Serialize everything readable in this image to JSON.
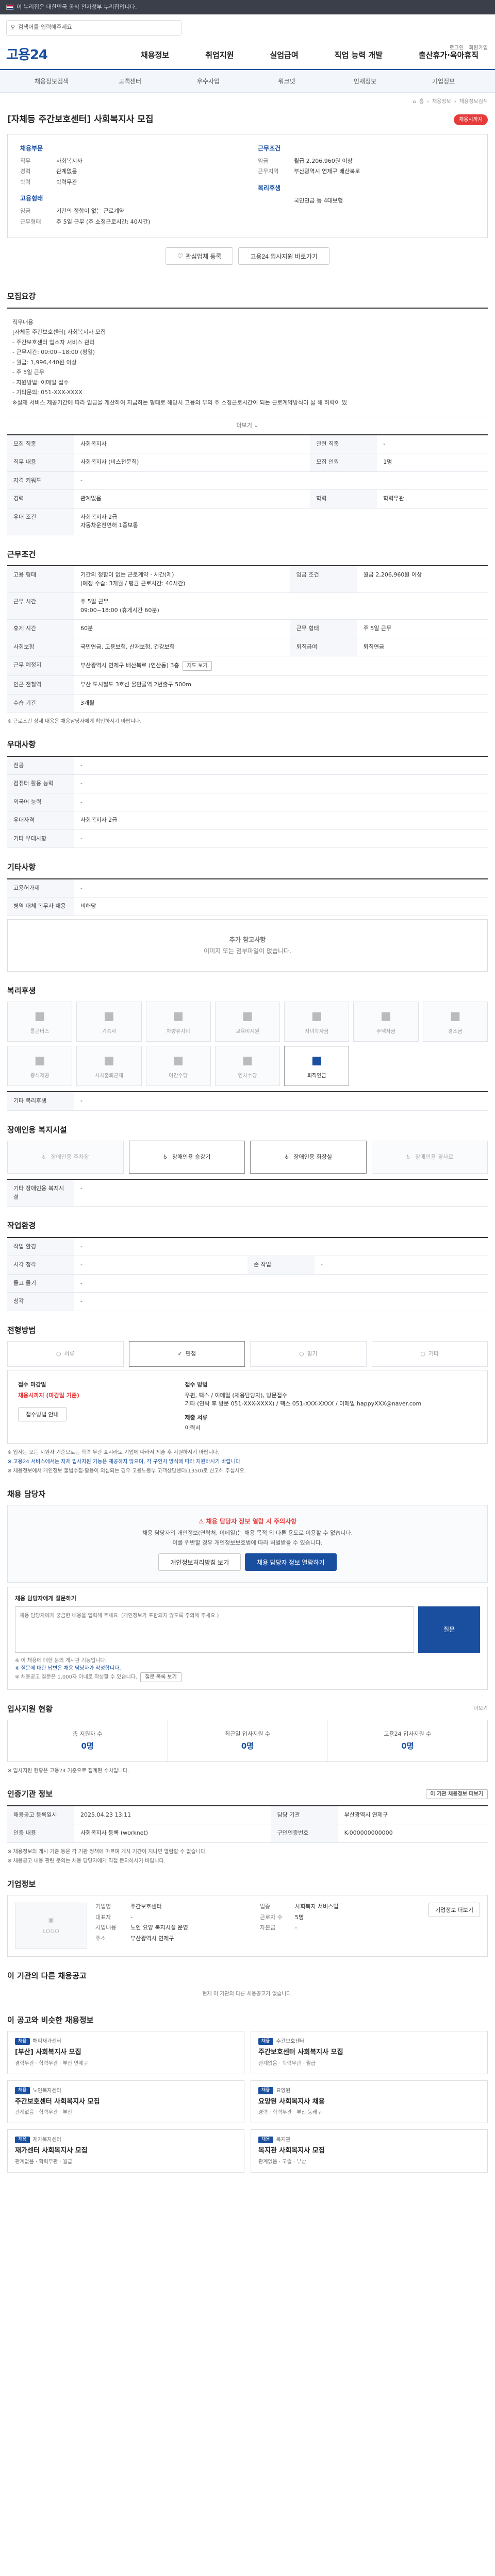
{
  "topbar": {
    "notice": "이 누리집은 대한민국 공식 전자정부 누리집입니다."
  },
  "search": {
    "placeholder": "검색어를 입력해주세요"
  },
  "util": {
    "login": "로그인",
    "join": "회원가입"
  },
  "logo": "고용24",
  "gnb": [
    "채용정보",
    "취업지원",
    "실업급여",
    "직업 능력 개발",
    "출산휴가·육아휴직"
  ],
  "subnav": [
    "채용정보검색",
    "고객센터",
    "우수사업",
    "워크넷",
    "인재정보",
    "기업정보"
  ],
  "breadcrumb": [
    "홈",
    "채용정보",
    "채용정보검색"
  ],
  "job": {
    "title": "[자체등 주간보호센터] 사회복지사 모집",
    "badge": "채용시까지",
    "summary_left_heading": "채용부문",
    "summary_left": [
      {
        "k": "직무",
        "v": "사회복지사"
      },
      {
        "k": "경력",
        "v": "관계없음"
      },
      {
        "k": "학력",
        "v": "학력무관"
      }
    ],
    "summary_left_heading2": "고용형태",
    "summary_left2": [
      {
        "k": "임금",
        "v": "기간의 정함이 없는 근로계약"
      },
      {
        "k": "근무형태",
        "v": "주 5일 근무 (주 소정근로시간: 40시간)"
      }
    ],
    "summary_right_heading": "근무조건",
    "summary_right": [
      {
        "k": "임금",
        "v": "월급 2,206,960원 이상"
      },
      {
        "k": "근무지역",
        "v": "부산광역시 연제구 배산북로"
      },
      {
        "k": "",
        "v": ""
      }
    ],
    "summary_right_heading2": "복리후생",
    "summary_right2": [
      {
        "k": "",
        "v": "국민연금 등 4대보험"
      }
    ],
    "btn_scrap": "관심업체 등록",
    "btn_share": "고용24 입사지원 바로가기"
  },
  "detail": {
    "heading": "모집요강",
    "lines": [
      "직무내용",
      "[자체등 주간보호센터] 사회복지사 모집",
      "- 주간보호센터 입소자 서비스 관리",
      "- 근무시간: 09:00~18:00 (평일)",
      "- 월급: 1,996,440원 이상",
      "- 주 5일 근무",
      "- 지원방법: 이메일 접수",
      "- 기타문의: 051-XXX-XXXX",
      "※실제 서비스 제공기간에 따라 임금을 개산하여 지급하는 형태로 해당시 고용의 부의 주 소정근로시간이 되는 근로계약방식이 될 해 허락이 있"
    ],
    "expand": "더보기"
  },
  "info_table": {
    "rows": [
      {
        "k": "모집 직종",
        "v": "사회복지사",
        "k2": "관련 직종",
        "v2": "-"
      },
      {
        "k": "직무 내용",
        "v": "사회복지사 (비스전문직)",
        "k2": "모집 인원",
        "v2": "1명"
      },
      {
        "k": "자격 키워드",
        "v": "-",
        "k2": "",
        "v2": ""
      },
      {
        "k": "경력",
        "v": "관계없음",
        "k2": "학력",
        "v2": "학력무관"
      },
      {
        "k": "우대 조건",
        "v": "사회복지사 2급\n자동차운전면허 1종보통",
        "k2": "",
        "v2": ""
      }
    ]
  },
  "work_cond": {
    "heading": "근무조건",
    "rows": [
      {
        "k": "고용 형태",
        "v": "기간의 정함이 없는 근로계약 · 시간(제)\n(예정 수습: 3개월 / 평균 근로시간: 40시간)",
        "k2": "임금 조건",
        "v2": "월급 2,206,960원 이상"
      },
      {
        "k": "근무 시간",
        "v": "주 5일 근무\n09:00~18:00 (휴게시간 60분)",
        "k2": "",
        "v2": ""
      },
      {
        "k": "휴게 시간",
        "v": "60분",
        "k2": "근무 형태",
        "v2": "주 5일 근무"
      },
      {
        "k": "사회보험",
        "v": "국민연금, 고용보험, 산재보험, 건강보험",
        "k2": "퇴직급여",
        "v2": "퇴직연금"
      },
      {
        "k": "근무 예정지",
        "v": "부산광역시 연제구 배산북로 (연산동) 3층",
        "k2": "",
        "v2": ""
      },
      {
        "k": "인근 전철역",
        "v": "부산 도시철도 3호선 물만골역 2번출구 500m",
        "k2": "",
        "v2": ""
      },
      {
        "k": "수습 기간",
        "v": "3개월",
        "k2": "",
        "v2": ""
      }
    ],
    "map_btn": "지도 보기",
    "note": "※ 근로조건 상세 내용은 채용담당자에게 확인하시기 바랍니다."
  },
  "preference": {
    "heading": "우대사항",
    "rows": [
      {
        "k": "전공",
        "v": "-"
      },
      {
        "k": "컴퓨터 활용 능력",
        "v": "-"
      },
      {
        "k": "외국어 능력",
        "v": "-"
      },
      {
        "k": "우대자격",
        "v": "사회복지사 2급"
      },
      {
        "k": "기타 우대사항",
        "v": "-"
      }
    ]
  },
  "etc": {
    "heading": "기타사항",
    "rows": [
      {
        "k": "고용허가제",
        "v": "-"
      },
      {
        "k": "병역 대체 복무자 채용",
        "v": "비해당"
      }
    ]
  },
  "extra": {
    "heading": "추가 참고사항",
    "empty": "이미지 또는 첨부파일이 없습니다."
  },
  "welfare": {
    "heading": "복리후생",
    "items": [
      {
        "label": "통근버스",
        "on": false
      },
      {
        "label": "기숙사",
        "on": false
      },
      {
        "label": "차량유지비",
        "on": false
      },
      {
        "label": "교육비지원",
        "on": false
      },
      {
        "label": "자녀학자금",
        "on": false
      },
      {
        "label": "주택자금",
        "on": false
      },
      {
        "label": "경조금",
        "on": false
      },
      {
        "label": "중식제공",
        "on": false
      },
      {
        "label": "시차출퇴근제",
        "on": false
      },
      {
        "label": "야간수당",
        "on": false
      },
      {
        "label": "연차수당",
        "on": false
      },
      {
        "label": "퇴직연금",
        "on": true
      }
    ],
    "other_label": "기타 복리후생",
    "other_value": "-"
  },
  "facility": {
    "heading": "장애인용 복지시설",
    "items": [
      {
        "label": "장애인용 주차장",
        "on": false
      },
      {
        "label": "장애인용 승강기",
        "on": true
      },
      {
        "label": "장애인용 화장실",
        "on": true
      },
      {
        "label": "장애인용 경사로",
        "on": false
      }
    ],
    "other_label": "기타 장애인용 복지시설",
    "other_value": "-"
  },
  "workenv": {
    "heading": "작업환경",
    "rows": [
      {
        "k": "작업 환경",
        "v": "-",
        "k2": "",
        "v2": ""
      },
      {
        "k": "시각 청각",
        "v": "-",
        "k2": "손 작업",
        "v2": "-"
      },
      {
        "k": "들고 들기",
        "v": "-",
        "k2": "",
        "v2": ""
      },
      {
        "k": "청각",
        "v": "-",
        "k2": "",
        "v2": ""
      }
    ]
  },
  "selection": {
    "heading": "전형방법",
    "steps": [
      {
        "label": "서류",
        "on": false
      },
      {
        "label": "면접",
        "on": true
      },
      {
        "label": "필기",
        "on": false
      },
      {
        "label": "기타",
        "on": false
      }
    ]
  },
  "apply": {
    "col1_label": "접수 마감일",
    "col1_value": "채용시까지 (마감일 기준)",
    "col1_btn": "접수방법 안내",
    "col2_label": "접수 방법",
    "col2_value": "우편, 팩스 / 이메일 (채용담당자), 방문접수\n기타 (연락 후 방문 051-XXX-XXXX) / 팩스 051-XXX-XXXX / 이메일 happyXXX@naver.com",
    "col2b_label": "제출 서류",
    "col2b_value": "이력서"
  },
  "apply_notes": [
    "※ 입사는 모든 지원자 기준으로는 학력 무관 표시라도 기업에 따라서 제출 후 지원하시기 바랍니다.",
    "※ 고용24 서비스에서는 자체 입사지원 기능은 제공하지 않으며, 각 구인처 방식에 따라 지원하시기 바랍니다.",
    "※ 채용정보에서 개인정보 불법수집·활용이 의심되는 경우 고용노동부 고객상담센터(1350)로 신고해 주십시오."
  ],
  "recruiter": {
    "heading": "채용 담당자",
    "warn": "채용 담당자 정보 열람 시 주의사항",
    "lines": [
      "채용 담당자의 개인정보(연락처, 이메일)는 채용 목적 외 다른 용도로 이용할 수 없습니다.",
      "이를 위반할 경우 개인정보보호법에 따라 처벌받을 수 있습니다."
    ],
    "btn1": "개인정보처리방침 보기",
    "btn2": "채용 담당자 정보 열람하기"
  },
  "inquiry": {
    "label": "채용 담당자에게 질문하기",
    "placeholder": "채용 담당자에게 궁금한 내용을 입력해 주세요. (개인정보가 포함되지 않도록 주의해 주세요.)",
    "submit": "질문",
    "notes": [
      "※ 이 채용에 대한 문의 게시판 기능입니다.",
      "※ 질문에 대한 답변은 채용 담당자가 작성합니다.",
      "※ 채용공고 질문은 1,000자 이내로 작성할 수 있습니다."
    ],
    "more": "질문 목록 보기"
  },
  "status": {
    "heading": "입사지원 현황",
    "more": "더보기",
    "items": [
      {
        "label": "총 지원자 수",
        "value": "0명"
      },
      {
        "label": "최근일 입사지원 수",
        "value": "0명"
      },
      {
        "label": "고용24 입사지원 수",
        "value": "0명"
      }
    ],
    "note": "※ 입사지원 현황은 고용24 기준으로 집계된 수치입니다."
  },
  "period": {
    "heading": "인증기관 정보",
    "more_btn": "이 기관 채용정보 더보기",
    "rows": [
      {
        "k": "채용공고 등록일시",
        "v": "2025.04.23 13:11",
        "k2": "담당 기관",
        "v2": "부산광역시 연제구"
      },
      {
        "k": "인증 내용",
        "v": "사회복지사 등록 (worknet)",
        "k2": "구인인증번호",
        "v2": "K-000000000000"
      }
    ],
    "notes": [
      "※ 채용정보의 게시 기준 등은 각 기관 정책에 따르며 게시 기간이 지나면 열람할 수 없습니다.",
      "※ 채용공고 내용 관련 문의는 채용 담당자에게 직접 문의하시기 바랍니다."
    ]
  },
  "agency": {
    "heading": "기업정보",
    "logo_text": "LOGO",
    "btn_more": "기업정보 더보기",
    "rows": [
      {
        "k": "기업명",
        "v": "주간보호센터",
        "k2": "업종",
        "v2": "사회복지 서비스업"
      },
      {
        "k": "대표자",
        "v": "-",
        "k2": "근로자 수",
        "v2": "5명"
      },
      {
        "k": "사업내용",
        "v": "노인 요양 복지시설 운영",
        "k2": "자본금",
        "v2": "-"
      },
      {
        "k": "주소",
        "v": "부산광역시 연제구",
        "k2": "",
        "v2": ""
      }
    ]
  },
  "similar": {
    "heading": "이 기관의 다른 채용공고",
    "note": "현재 이 기관의 다른 채용공고가 없습니다."
  },
  "recommend": {
    "heading": "이 공고와 비슷한 채용정보",
    "cards": [
      {
        "org": "해피재가센터",
        "tag": "채용",
        "title": "[부산] 사회복지사 모집",
        "meta": "경력무관 · 학력무관 · 부산 연제구"
      },
      {
        "org": "주간보호센터",
        "tag": "채용",
        "title": "주간보호센터 사회복지사 모집",
        "meta": "관계없음 · 학력무관 · 월급"
      },
      {
        "org": "노인복지센터",
        "tag": "채용",
        "title": "주간보호센터 사회복지사 모집",
        "meta": "관계없음 · 학력무관 · 부산"
      },
      {
        "org": "요양원",
        "tag": "채용",
        "title": "요양원 사회복지사 채용",
        "meta": "경력 · 학력무관 · 부산 동래구"
      },
      {
        "org": "재가복지센터",
        "tag": "채용",
        "title": "재가센터 사회복지사 모집",
        "meta": "관계없음 · 학력무관 · 월급"
      },
      {
        "org": "복지관",
        "tag": "채용",
        "title": "복지관 사회복지사 모집",
        "meta": "관계없음 · 고졸 · 부산"
      }
    ]
  }
}
